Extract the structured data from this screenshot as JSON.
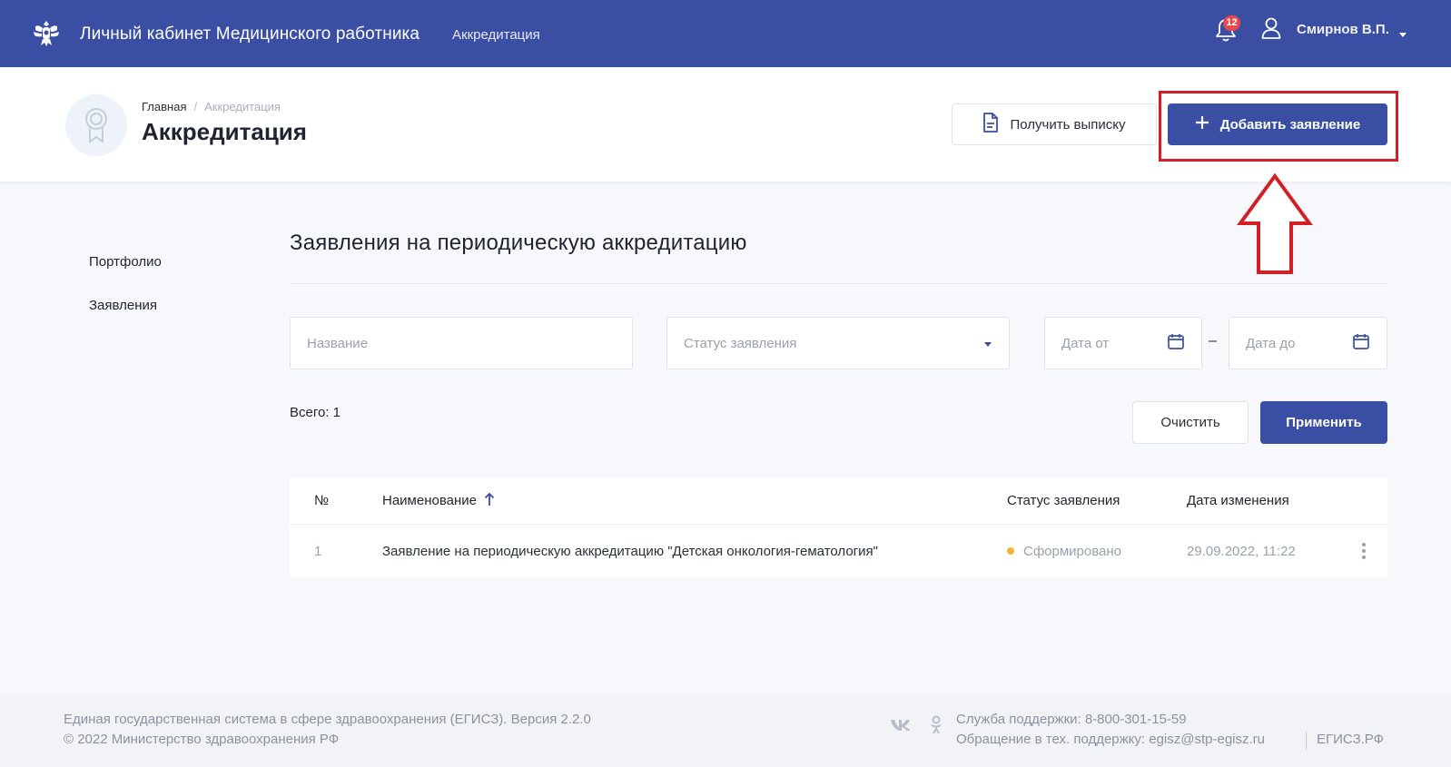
{
  "topbar": {
    "app_title": "Личный кабинет Медицинского работника",
    "nav_link": "Аккредитация",
    "notifications_count": "12",
    "user_name": "Смирнов В.П."
  },
  "header": {
    "breadcrumb": [
      "Главная",
      "Аккредитация"
    ],
    "title": "Аккредитация",
    "get_statement_label": "Получить выписку",
    "add_application_label": "Добавить заявление"
  },
  "sidebar": {
    "items": [
      {
        "label": "Портфолио"
      },
      {
        "label": "Заявления"
      }
    ]
  },
  "main": {
    "section_title": "Заявления на периодическую аккредитацию",
    "filters": {
      "name_placeholder": "Название",
      "status_placeholder": "Статус заявления",
      "date_from_placeholder": "Дата от",
      "date_separator": "–",
      "date_to_placeholder": "Дата до"
    },
    "total_label": "Всего: 1",
    "clear_label": "Очистить",
    "apply_label": "Применить",
    "table": {
      "headers": {
        "num": "№",
        "name": "Наименование",
        "status": "Статус заявления",
        "date": "Дата изменения"
      },
      "rows": [
        {
          "num": "1",
          "name": "Заявление на периодическую аккредитацию \"Детская онкология-гематология\"",
          "status": "Сформировано",
          "date": "29.09.2022, 11:22"
        }
      ]
    }
  },
  "footer": {
    "line1": "Единая государственная система в сфере здравоохранения (ЕГИСЗ). Версия 2.2.0",
    "line2": "© 2022 Министерство здравоохранения РФ",
    "support_phone": "Служба поддержки: 8-800-301-15-59",
    "support_email": "Обращение в тех. поддержку: egisz@stp-egisz.ru",
    "site": "ЕГИСЗ.РФ"
  },
  "colors": {
    "brand": "#3a4fa4",
    "highlight": "#d32027",
    "status_formed": "#f2b531",
    "badge": "#e5484d"
  },
  "icons": [
    "emblem-icon",
    "bell-icon",
    "user-icon",
    "caret-down-icon",
    "award-icon",
    "document-icon",
    "plus-icon",
    "calendar-icon",
    "sort-up-icon",
    "kebab-menu-icon",
    "vk-icon",
    "odnoklassniki-icon"
  ]
}
